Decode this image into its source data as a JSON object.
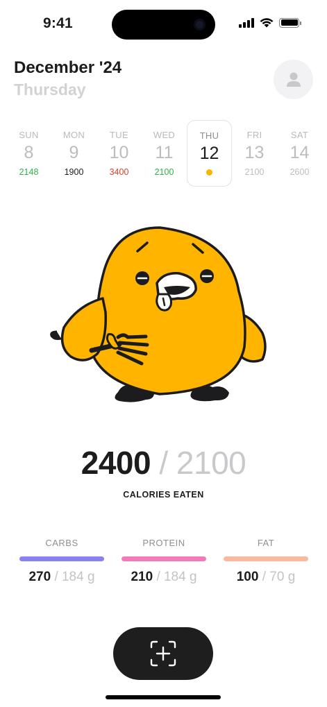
{
  "status_bar": {
    "time": "9:41",
    "icons": [
      "cellular-signal-icon",
      "wifi-icon",
      "battery-icon"
    ]
  },
  "header": {
    "month": "December '24",
    "weekday": "Thursday",
    "avatar_icon": "user-icon"
  },
  "week": [
    {
      "name": "SUN",
      "num": "8",
      "calories": "2148",
      "cal_color": "#2fb344"
    },
    {
      "name": "MON",
      "num": "9",
      "calories": "1900",
      "cal_color": "#1c1c1e"
    },
    {
      "name": "TUE",
      "num": "10",
      "calories": "3400",
      "cal_color": "#e53b2b"
    },
    {
      "name": "WED",
      "num": "11",
      "calories": "2100",
      "cal_color": "#2fb344"
    },
    {
      "name": "THU",
      "num": "12",
      "calories": "",
      "selected": true,
      "dot_color": "#f7b500"
    },
    {
      "name": "FRI",
      "num": "13",
      "calories": "2100",
      "cal_color": "#bdbdc1"
    },
    {
      "name": "SAT",
      "num": "14",
      "calories": "2600",
      "cal_color": "#bdbdc1"
    }
  ],
  "mascot": {
    "description_icon": "chick-mascot-with-fork",
    "body_color": "#ffb400",
    "outline_color": "#1c1c1e"
  },
  "calories": {
    "eaten": "2400",
    "separator": "/",
    "goal": "2100",
    "label": "CALORIES EATEN"
  },
  "macros": [
    {
      "name": "CARBS",
      "eaten": "270",
      "goal": "/ 184 g",
      "color": "#8b80f0"
    },
    {
      "name": "PROTEIN",
      "eaten": "210",
      "goal": "/ 184 g",
      "color": "#f27ab8"
    },
    {
      "name": "FAT",
      "eaten": "100",
      "goal": "/ 70 g",
      "color": "#f8b99c"
    }
  ],
  "scan_button": {
    "icon": "scan-add-icon"
  }
}
